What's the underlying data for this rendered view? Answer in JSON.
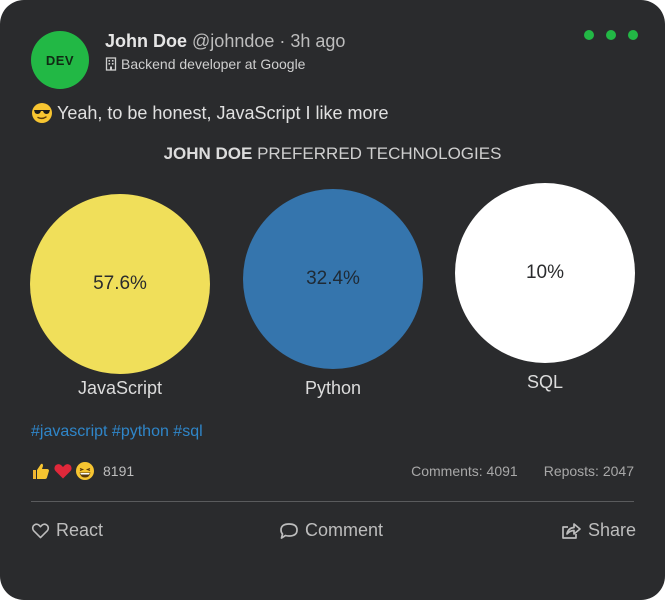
{
  "author": {
    "avatar_text": "DEV",
    "name": "John Doe",
    "handle": "@johndoe",
    "time": "· 3h ago",
    "role": "Backend developer at Google"
  },
  "post": {
    "text": "Yeah, to be honest, JavaScript I like more",
    "hashtags": "#javascript #python #sql"
  },
  "chart_data": {
    "type": "pie",
    "title_bold": "JOHN DOE",
    "title_rest": " PREFERRED TECHNOLOGIES",
    "categories": [
      "JavaScript",
      "Python",
      "SQL"
    ],
    "values": [
      57.6,
      32.4,
      10
    ],
    "labels": [
      "57.6%",
      "32.4%",
      "10%"
    ],
    "colors": [
      "#f0df5a",
      "#3575ad",
      "#ffffff"
    ]
  },
  "engagement": {
    "reaction_count": "8191",
    "comments": "Comments: 4091",
    "reposts": "Reposts: 2047"
  },
  "actions": {
    "react": "React",
    "comment": "Comment",
    "share": "Share"
  },
  "colors": {
    "card_bg": "#2a2b2d",
    "accent_green": "#22b845",
    "hashtag_blue": "#2f86c9"
  }
}
